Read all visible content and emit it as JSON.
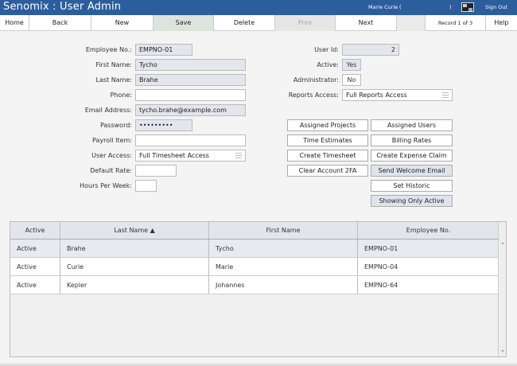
{
  "app": {
    "title": "Senomix : User Admin",
    "user_name": "Marie Curie",
    "user_open": "(",
    "user_close": ")",
    "sign_out": "Sign Out"
  },
  "toolbar": {
    "home": "Home",
    "back": "Back",
    "new": "New",
    "save": "Save",
    "delete": "Delete",
    "prev": "Prev",
    "next": "Next",
    "record": "Record 1 of 3",
    "help": "Help"
  },
  "form": {
    "employee_no": {
      "label": "Employee No.:",
      "value": "EMPNO-01"
    },
    "first_name": {
      "label": "First Name:",
      "value": "Tycho"
    },
    "last_name": {
      "label": "Last Name:",
      "value": "Brahe"
    },
    "phone": {
      "label": "Phone:",
      "value": ""
    },
    "email": {
      "label": "Email Address:",
      "value": "tycho.brahe@example.com"
    },
    "password": {
      "label": "Password:",
      "value": "•••••••••"
    },
    "payroll": {
      "label": "Payroll Item:",
      "value": ""
    },
    "user_access": {
      "label": "User Access:",
      "value": "Full Timesheet Access"
    },
    "default_rate": {
      "label": "Default Rate:",
      "value": ""
    },
    "hours_per_week": {
      "label": "Hours Per Week:",
      "value": ""
    },
    "user_id": {
      "label": "User Id:",
      "value": "2"
    },
    "active": {
      "label": "Active:",
      "value": "Yes"
    },
    "administrator": {
      "label": "Administrator:",
      "value": "No"
    },
    "reports_access": {
      "label": "Reports Access:",
      "value": "Full Reports Access"
    }
  },
  "actions": {
    "assigned_projects": "Assigned Projects",
    "assigned_users": "Assigned Users",
    "time_estimates": "Time Estimates",
    "billing_rates": "Billing Rates",
    "create_timesheet": "Create Timesheet",
    "create_expense": "Create Expense Claim",
    "clear_2fa": "Clear Account 2FA",
    "send_welcome": "Send Welcome Email",
    "set_historic": "Set Historic",
    "showing_active": "Showing Only Active"
  },
  "grid": {
    "headers": [
      "Active",
      "Last Name ▲",
      "First Name",
      "Employee No."
    ],
    "rows": [
      [
        "Active",
        "Brahe",
        "Tycho",
        "EMPNO-01"
      ],
      [
        "Active",
        "Curie",
        "Marie",
        "EMPNO-04"
      ],
      [
        "Active",
        "Kepler",
        "Johannes",
        "EMPNO-64"
      ]
    ]
  },
  "colors": {
    "title_bar": "#2c5e9e",
    "selected_row": "#e7eaf0"
  }
}
